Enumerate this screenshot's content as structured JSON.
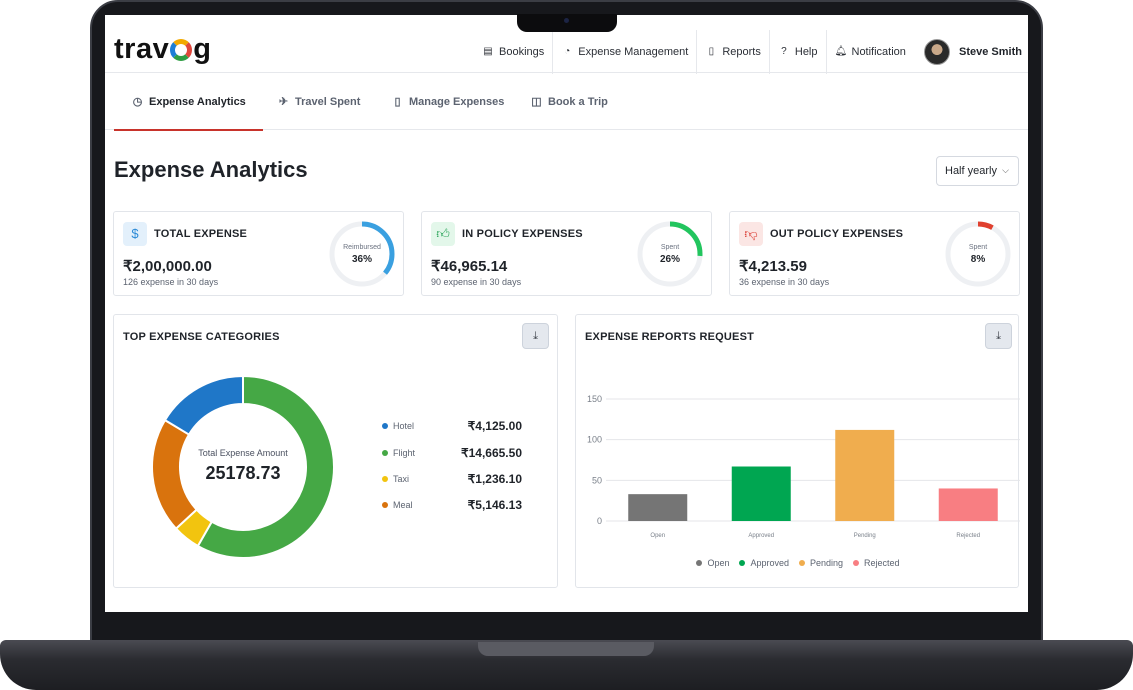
{
  "app": {
    "brand": "travog",
    "brand_parts": [
      "trav",
      "g"
    ]
  },
  "topnav": {
    "items": [
      {
        "label": "Bookings",
        "icon": "document-icon"
      },
      {
        "label": "Expense Management",
        "icon": "expense-icon"
      },
      {
        "label": "Reports",
        "icon": "report-icon"
      },
      {
        "label": "Help",
        "icon": "help-icon"
      },
      {
        "label": "Notification",
        "icon": "bell-icon"
      }
    ],
    "user": {
      "name": "Steve Smith"
    }
  },
  "tabs": [
    {
      "label": "Expense Analytics",
      "icon": "analytics-icon",
      "active": true
    },
    {
      "label": "Travel Spent",
      "icon": "travel-icon",
      "active": false
    },
    {
      "label": "Manage Expenses",
      "icon": "receipt-icon",
      "active": false
    },
    {
      "label": "Book a Trip",
      "icon": "luggage-icon",
      "active": false
    }
  ],
  "page": {
    "title": "Expense Analytics",
    "period_select": "Half yearly"
  },
  "cards": [
    {
      "title": "TOTAL EXPENSE",
      "value": "₹2,00,000.00",
      "subtitle": "126 expense in 30 days",
      "gauge_label": "Reimbursed",
      "gauge_pct": "36%",
      "gauge_fraction": 0.36,
      "accent": "#3aa0e0",
      "icon": "dollar-icon",
      "icon_bg": "#e3f0fb"
    },
    {
      "title": "IN POLICY EXPENSES",
      "value": "₹46,965.14",
      "subtitle": "90 expense in 30 days",
      "gauge_label": "Spent",
      "gauge_pct": "26%",
      "gauge_fraction": 0.26,
      "accent": "#22c55e",
      "icon": "thumbs-up-icon",
      "icon_bg": "#e3f7ea"
    },
    {
      "title": "OUT POLICY EXPENSES",
      "value": "₹4,213.59",
      "subtitle": "36 expense in 30 days",
      "gauge_label": "Spent",
      "gauge_pct": "8%",
      "gauge_fraction": 0.08,
      "accent": "#e0402f",
      "icon": "thumbs-down-icon",
      "icon_bg": "#fbe6e4"
    }
  ],
  "top_categories": {
    "title": "TOP EXPENSE CATEGORIES",
    "center_label": "Total Expense Amount",
    "center_value": "25178.73",
    "items": [
      {
        "name": "Hotel",
        "amount": "₹4,125.00",
        "value": 4125.0,
        "color": "#1f77c8"
      },
      {
        "name": "Flight",
        "amount": "₹14,665.50",
        "value": 14665.5,
        "color": "#45a845"
      },
      {
        "name": "Taxi",
        "amount": "₹1,236.10",
        "value": 1236.1,
        "color": "#f2c40f"
      },
      {
        "name": "Meal",
        "amount": "₹5,146.13",
        "value": 5146.13,
        "color": "#d9730d"
      }
    ]
  },
  "chart_data": {
    "type": "bar",
    "title": "EXPENSE REPORTS REQUEST",
    "categories": [
      "Open",
      "Approved",
      "Pending",
      "Rejected"
    ],
    "values": [
      33,
      67,
      112,
      40
    ],
    "colors": [
      "#757575",
      "#00a651",
      "#f0ad4e",
      "#f87e82"
    ],
    "yticks": [
      "150",
      "100",
      "50",
      "0"
    ],
    "ylim": [
      0,
      150
    ],
    "grid": true,
    "legend_position": "bottom"
  }
}
